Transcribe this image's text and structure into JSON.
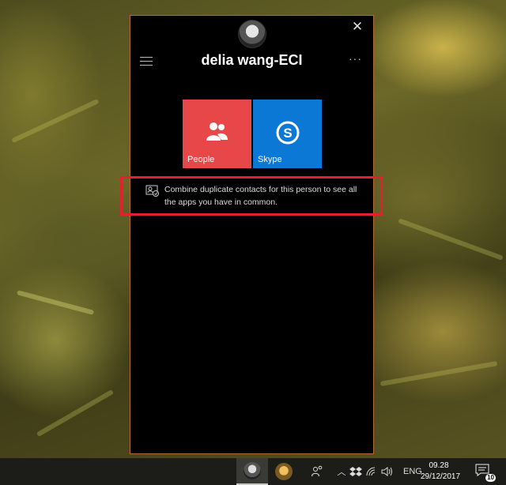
{
  "card": {
    "contact_name": "delia wang-ECI",
    "close_glyph": "✕",
    "more_glyph": "···",
    "apps": [
      {
        "label": "People",
        "color": "#e8474a",
        "icon": "people-icon"
      },
      {
        "label": "Skype",
        "color": "#0a78d4",
        "icon": "skype-icon"
      }
    ],
    "combine_message": "Combine duplicate contacts for this person to see all the apps you have in common."
  },
  "taskbar": {
    "language": "ENG",
    "time": "09.28",
    "date": "29/12/2017",
    "notification_count": "10"
  },
  "colors": {
    "highlight": "#e3202e",
    "card_border": "#b06a3a"
  }
}
